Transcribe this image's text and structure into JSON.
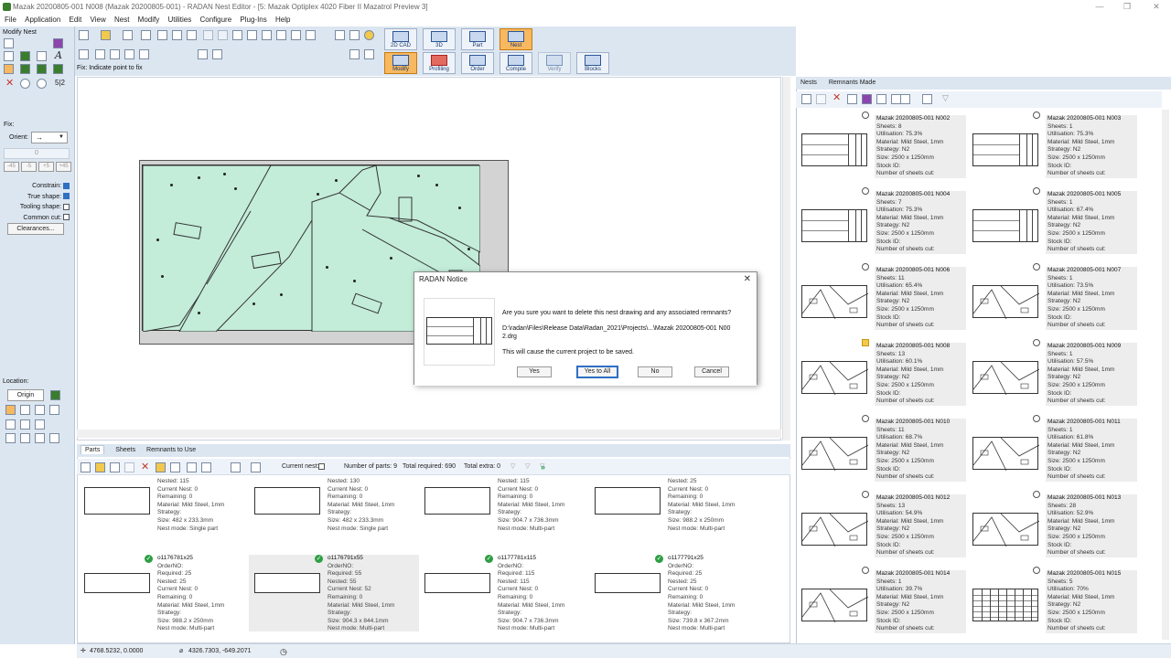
{
  "window": {
    "title": "Mazak 20200805-001 N008 (Mazak 20200805-001) - RADAN Nest Editor - [5: Mazak Optiplex 4020 Fiber II Mazatrol Preview 3]"
  },
  "menu": [
    "File",
    "Application",
    "Edit",
    "View",
    "Nest",
    "Modify",
    "Utilities",
    "Configure",
    "Plug-Ins",
    "Help"
  ],
  "left_panel": {
    "title": "Modify Nest",
    "fix_label": "Fix:",
    "orient_label": "Orient:",
    "orient_value": "→",
    "angle_value": "0",
    "angle_buttons": [
      "-45",
      "-5",
      "+5",
      "+45"
    ],
    "checkboxes": [
      {
        "label": "Constrain:",
        "checked": true
      },
      {
        "label": "True shape:",
        "checked": true
      },
      {
        "label": "Tooling shape:",
        "checked": false
      },
      {
        "label": "Common cut:",
        "checked": false
      }
    ],
    "clearances_button": "Clearances...",
    "location_label": "Location:",
    "origin_button": "Origin",
    "fraction_icon": "5|2"
  },
  "toolbar": {
    "hint": "Fix: Indicate point to fix",
    "big_buttons": [
      {
        "label": "2D CAD",
        "active": false
      },
      {
        "label": "3D",
        "active": false
      },
      {
        "label": "Part",
        "active": false
      },
      {
        "label": "Nest",
        "active": true
      }
    ],
    "mode_buttons": [
      {
        "label": "Modify",
        "active": true
      },
      {
        "label": "Profiling",
        "active": false
      },
      {
        "label": "Order",
        "active": false
      },
      {
        "label": "Compile",
        "active": false
      },
      {
        "label": "Verify",
        "active": false
      },
      {
        "label": "Blocks",
        "active": false
      }
    ]
  },
  "bottom_panel": {
    "tabs": [
      "Parts",
      "Sheets",
      "Remnants to Use"
    ],
    "current_nest_label": "Current nest:",
    "number_of_parts": "Number of parts: 9",
    "total_required": "Total required: 690",
    "total_extra": "Total extra: 0",
    "parts": [
      {
        "name": "",
        "lines": [
          "Nested: 115",
          "Current Nest: 0",
          "Remaining: 0",
          "Material: Mild Steel, 1mm",
          "Strategy:",
          "Size: 482 x 233.3mm",
          "Nest mode: Single part"
        ],
        "selected": false
      },
      {
        "name": "",
        "lines": [
          "Nested: 130",
          "Current Nest: 0",
          "Remaining: 0",
          "Material: Mild Steel, 1mm",
          "Strategy:",
          "Size: 482 x 233.3mm",
          "Nest mode: Single part"
        ],
        "selected": false
      },
      {
        "name": "",
        "lines": [
          "Nested: 115",
          "Current Nest: 0",
          "Remaining: 0",
          "Material: Mild Steel, 1mm",
          "Strategy:",
          "Size: 904.7 x 736.3mm",
          "Nest mode: Multi-part"
        ],
        "selected": false
      },
      {
        "name": "",
        "lines": [
          "Nested: 25",
          "Current Nest: 0",
          "Remaining: 0",
          "Material: Mild Steel, 1mm",
          "Strategy:",
          "Size: 988.2 x 250mm",
          "Nest mode: Multi-part"
        ],
        "selected": false
      },
      {
        "name": "o1176781x25",
        "lines": [
          "OrderNO:",
          "Required: 25",
          "Nested: 25",
          "Current Nest: 0",
          "Remaining: 0",
          "Material: Mild Steel, 1mm",
          "Strategy:",
          "Size: 988.2 x 250mm",
          "Nest mode: Multi-part"
        ],
        "selected": false
      },
      {
        "name": "o1176791x55",
        "lines": [
          "OrderNO:",
          "Required: 55",
          "Nested: 55",
          "Current Nest: 52",
          "Remaining: 0",
          "Material: Mild Steel, 1mm",
          "Strategy:",
          "Size: 904.3 x 844.1mm",
          "Nest mode: Multi-part"
        ],
        "selected": true
      },
      {
        "name": "o1177781x115",
        "lines": [
          "OrderNO:",
          "Required: 115",
          "Nested: 115",
          "Current Nest: 0",
          "Remaining: 0",
          "Material: Mild Steel, 1mm",
          "Strategy:",
          "Size: 904.7 x 736.3mm",
          "Nest mode: Multi-part"
        ],
        "selected": false
      },
      {
        "name": "o1177791x25",
        "lines": [
          "OrderNO:",
          "Required: 25",
          "Nested: 25",
          "Current Nest: 0",
          "Remaining: 0",
          "Material: Mild Steel, 1mm",
          "Strategy:",
          "Size: 739.8 x 367.2mm",
          "Nest mode: Multi-part"
        ],
        "selected": false
      }
    ]
  },
  "right_panel": {
    "tabs": [
      "Nests",
      "Remnants Made"
    ],
    "nests": [
      {
        "name": "Mazak 20200805-001 N002",
        "sheets": "Sheets: 8",
        "util": "Utilisation: 75.3%",
        "material": "Material: Mild Steel, 1mm",
        "strategy": "Strategy: N2",
        "size": "Size: 2500 x 1250mm",
        "stock": "Stock ID:",
        "cut": "Number of sheets cut:"
      },
      {
        "name": "Mazak 20200805-001 N003",
        "sheets": "Sheets: 1",
        "util": "Utilisation: 75.3%",
        "material": "Material: Mild Steel, 1mm",
        "strategy": "Strategy: N2",
        "size": "Size: 2500 x 1250mm",
        "stock": "Stock ID:",
        "cut": "Number of sheets cut:"
      },
      {
        "name": "Mazak 20200805-001 N004",
        "sheets": "Sheets: 7",
        "util": "Utilisation: 75.3%",
        "material": "Material: Mild Steel, 1mm",
        "strategy": "Strategy: N2",
        "size": "Size: 2500 x 1250mm",
        "stock": "Stock ID:",
        "cut": "Number of sheets cut:"
      },
      {
        "name": "Mazak 20200805-001 N005",
        "sheets": "Sheets: 1",
        "util": "Utilisation: 67.4%",
        "material": "Material: Mild Steel, 1mm",
        "strategy": "Strategy: N2",
        "size": "Size: 2500 x 1250mm",
        "stock": "Stock ID:",
        "cut": "Number of sheets cut:"
      },
      {
        "name": "Mazak 20200805-001 N006",
        "sheets": "Sheets: 11",
        "util": "Utilisation: 65.4%",
        "material": "Material: Mild Steel, 1mm",
        "strategy": "Strategy: N2",
        "size": "Size: 2500 x 1250mm",
        "stock": "Stock ID:",
        "cut": "Number of sheets cut:"
      },
      {
        "name": "Mazak 20200805-001 N007",
        "sheets": "Sheets: 1",
        "util": "Utilisation: 73.5%",
        "material": "Material: Mild Steel, 1mm",
        "strategy": "Strategy: N2",
        "size": "Size: 2500 x 1250mm",
        "stock": "Stock ID:",
        "cut": "Number of sheets cut:"
      },
      {
        "name": "Mazak 20200805-001 N008",
        "sheets": "Sheets: 13",
        "util": "Utilisation: 60.1%",
        "material": "Material: Mild Steel, 1mm",
        "strategy": "Strategy: N2",
        "size": "Size: 2500 x 1250mm",
        "stock": "Stock ID:",
        "cut": "Number of sheets cut:"
      },
      {
        "name": "Mazak 20200805-001 N009",
        "sheets": "Sheets: 1",
        "util": "Utilisation: 57.5%",
        "material": "Material: Mild Steel, 1mm",
        "strategy": "Strategy: N2",
        "size": "Size: 2500 x 1250mm",
        "stock": "Stock ID:",
        "cut": "Number of sheets cut:"
      },
      {
        "name": "Mazak 20200805-001 N010",
        "sheets": "Sheets: 11",
        "util": "Utilisation: 68.7%",
        "material": "Material: Mild Steel, 1mm",
        "strategy": "Strategy: N2",
        "size": "Size: 2500 x 1250mm",
        "stock": "Stock ID:",
        "cut": "Number of sheets cut:"
      },
      {
        "name": "Mazak 20200805-001 N011",
        "sheets": "Sheets: 1",
        "util": "Utilisation: 61.8%",
        "material": "Material: Mild Steel, 1mm",
        "strategy": "Strategy: N2",
        "size": "Size: 2500 x 1250mm",
        "stock": "Stock ID:",
        "cut": "Number of sheets cut:"
      },
      {
        "name": "Mazak 20200805-001 N012",
        "sheets": "Sheets: 13",
        "util": "Utilisation: 54.9%",
        "material": "Material: Mild Steel, 1mm",
        "strategy": "Strategy: N2",
        "size": "Size: 2500 x 1250mm",
        "stock": "Stock ID:",
        "cut": "Number of sheets cut:"
      },
      {
        "name": "Mazak 20200805-001 N013",
        "sheets": "Sheets: 28",
        "util": "Utilisation: 52.9%",
        "material": "Material: Mild Steel, 1mm",
        "strategy": "Strategy: N2",
        "size": "Size: 2500 x 1250mm",
        "stock": "Stock ID:",
        "cut": "Number of sheets cut:"
      },
      {
        "name": "Mazak 20200805-001 N014",
        "sheets": "Sheets: 1",
        "util": "Utilisation: 39.7%",
        "material": "Material: Mild Steel, 1mm",
        "strategy": "Strategy: N2",
        "size": "Size: 2500 x 1250mm",
        "stock": "Stock ID:",
        "cut": "Number of sheets cut:"
      },
      {
        "name": "Mazak 20200805-001 N015",
        "sheets": "Sheets: 5",
        "util": "Utilisation: 70%",
        "material": "Material: Mild Steel, 1mm",
        "strategy": "Strategy: N2",
        "size": "Size: 2500 x 1250mm",
        "stock": "Stock ID:",
        "cut": "Number of sheets cut:"
      }
    ]
  },
  "dialog": {
    "title": "RADAN Notice",
    "question": "Are you sure you want to delete this nest drawing and any associated remnants?",
    "path": "D:\\radan\\Files\\Release Data\\Radan_2021\\Projects\\...\\Mazak 20200805-001 N002.drg",
    "note": "This will cause the current project to be saved.",
    "buttons": {
      "yes": "Yes",
      "yes_to_all": "Yes to All",
      "no": "No",
      "cancel": "Cancel"
    }
  },
  "status": {
    "coord1": "4768.5232, 0.0000",
    "coord2": "4326.7303, -649.2071"
  },
  "colors": {
    "nest_fill": "#c3ecd9",
    "accent": "#f7b860",
    "panel": "#dce6f1"
  }
}
